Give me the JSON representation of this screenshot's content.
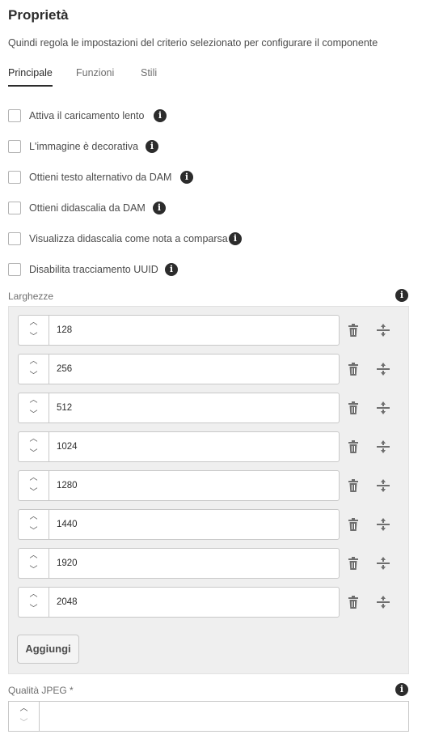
{
  "header": {
    "title": "Proprietà",
    "subtitle": "Quindi regola le impostazioni del criterio selezionato per configurare il componente"
  },
  "tabs": [
    {
      "label": "Principale",
      "active": true
    },
    {
      "label": "Funzioni",
      "active": false
    },
    {
      "label": "Stili",
      "active": false
    }
  ],
  "checkboxes": [
    {
      "label": "Attiva il caricamento lento",
      "checked": false,
      "icon": "info-icon"
    },
    {
      "label": "L'immagine è decorativa",
      "checked": false,
      "icon": "info-icon"
    },
    {
      "label": "Ottieni testo alternativo da DAM",
      "checked": false,
      "icon": "info-icon"
    },
    {
      "label": "Ottieni didascalia da DAM",
      "checked": false,
      "icon": "info-icon"
    },
    {
      "label": "Visualizza didascalia come nota a comparsa",
      "checked": false,
      "icon": "info-icon"
    },
    {
      "label": "Disabilita tracciamento UUID",
      "checked": false,
      "icon": "info-icon"
    }
  ],
  "widths": {
    "label": "Larghezze",
    "values": [
      "128",
      "256",
      "512",
      "1024",
      "1280",
      "1440",
      "1920",
      "2048"
    ],
    "add_label": "Aggiungi"
  },
  "jpeg_quality": {
    "label": "Qualità JPEG *",
    "value": ""
  },
  "icons": {
    "info": "i",
    "stepper_up": "︿",
    "stepper_down": "﹀"
  }
}
